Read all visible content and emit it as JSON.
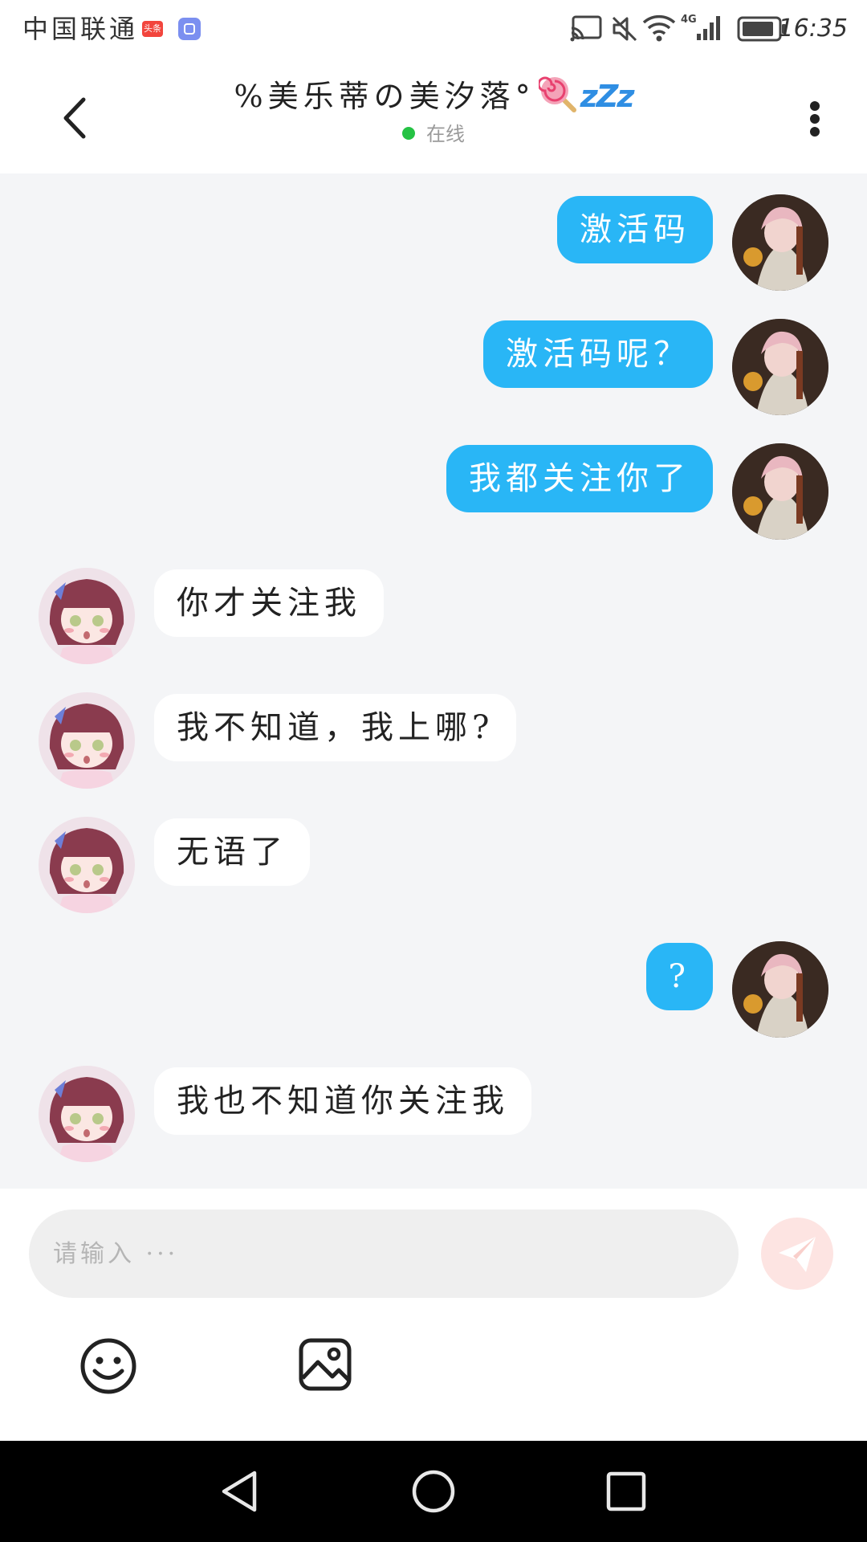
{
  "status_bar": {
    "carrier": "中国联通",
    "toutiao_badge": "头条",
    "time": "16:35",
    "network": "4G"
  },
  "header": {
    "title": "%美乐蒂の美汐落°",
    "title_emoji_1": "lollipop",
    "title_emoji_2": "zzz",
    "zzz_text": "zZz",
    "status": "在线",
    "status_color": "#25c244"
  },
  "messages": [
    {
      "side": "sent",
      "text": "激活码",
      "avatar": "self-avatar"
    },
    {
      "side": "sent",
      "text": "激活码呢？",
      "avatar": "self-avatar"
    },
    {
      "side": "sent",
      "text": "我都关注你了",
      "avatar": "self-avatar"
    },
    {
      "side": "received",
      "text": "你才关注我",
      "avatar": "contact-avatar"
    },
    {
      "side": "received",
      "text": "我不知道，我上哪?",
      "avatar": "contact-avatar"
    },
    {
      "side": "received",
      "text": "无语了",
      "avatar": "contact-avatar"
    },
    {
      "side": "sent",
      "text": "?",
      "avatar": "self-avatar"
    },
    {
      "side": "received",
      "text": "我也不知道你关注我",
      "avatar": "contact-avatar"
    }
  ],
  "input": {
    "placeholder": "请输入 ···",
    "value": ""
  },
  "toolbar": {
    "icons": [
      "emoji-icon",
      "image-icon"
    ],
    "send_icon": "paper-plane-icon"
  },
  "colors": {
    "sent_bubble": "#29b6f6",
    "received_bubble": "#ffffff",
    "chat_background": "#f4f5f7",
    "send_button": "#fde4e2"
  }
}
